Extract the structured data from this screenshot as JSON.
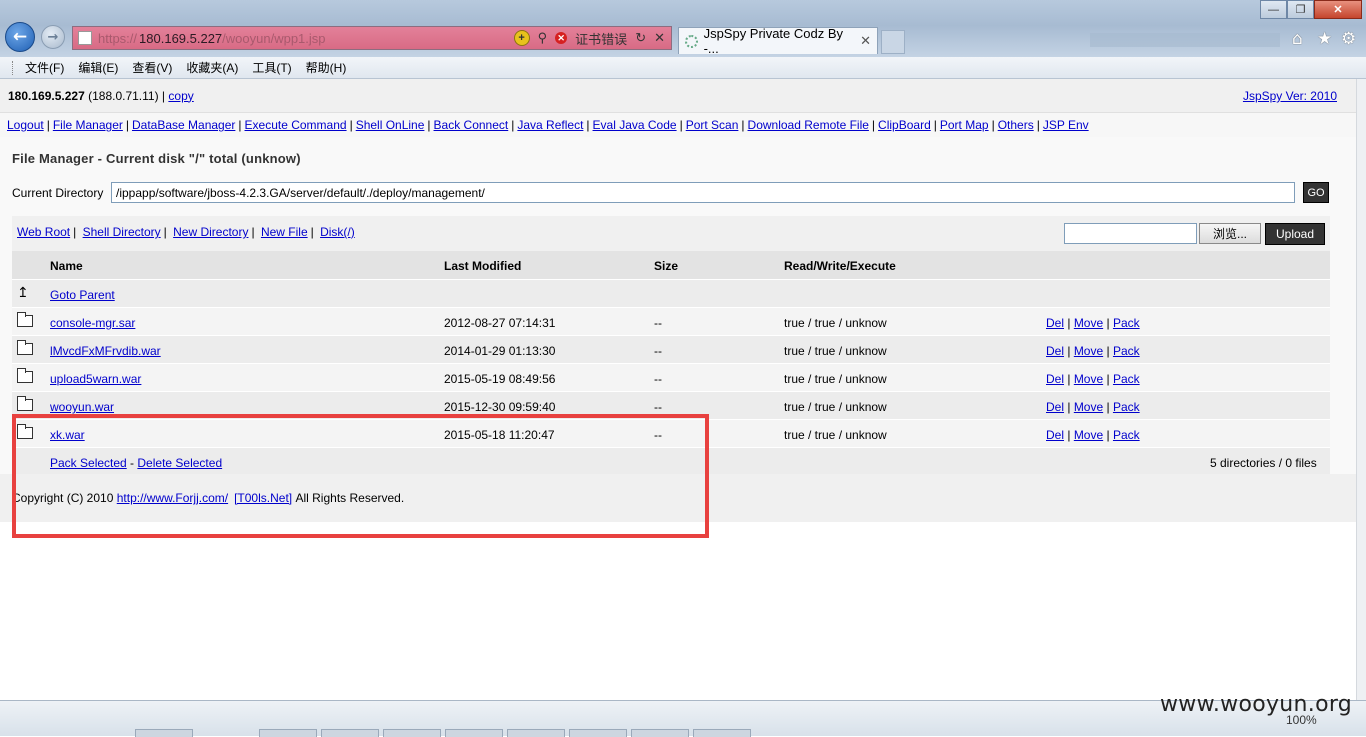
{
  "browser": {
    "url_scheme": "https://",
    "url_host": "180.169.5.227",
    "url_path": "/wooyun/wpp1.jsp",
    "cert_error": "证书错误",
    "tab_title": "JspSpy Private Codz By -...",
    "menu": [
      "文件(F)",
      "编辑(E)",
      "查看(V)",
      "收藏夹(A)",
      "工具(T)",
      "帮助(H)"
    ],
    "zoom": "100%"
  },
  "header": {
    "ip": "180.169.5.227",
    "local_ip": "(188.0.71.11)",
    "copy_label": "copy",
    "version_label": "JspSpy Ver: 2010"
  },
  "nav": [
    "Logout",
    "File Manager",
    "DataBase Manager",
    "Execute Command",
    "Shell OnLine",
    "Back Connect",
    "Java Reflect",
    "Eval Java Code",
    "Port Scan",
    "Download Remote File",
    "ClipBoard",
    "Port Map",
    "Others",
    "JSP Env"
  ],
  "file_manager": {
    "title": "File Manager - Current disk \"/\" total (unknow)",
    "current_directory_label": "Current Directory",
    "current_directory": "/ippapp/software/jboss-4.2.3.GA/server/default/./deploy/management/",
    "go_label": "GO",
    "dir_links": [
      "Web Root",
      "Shell Directory",
      "New Directory",
      "New File",
      "Disk(/)"
    ],
    "browse_label": "浏览...",
    "upload_label": "Upload",
    "columns": [
      "Name",
      "Last Modified",
      "Size",
      "Read/Write/Execute"
    ],
    "goto_parent": "Goto Parent",
    "rows": [
      {
        "name": "console-mgr.sar",
        "modified": "2012-08-27 07:14:31",
        "size": "--",
        "rwx": "true / true / unknow"
      },
      {
        "name": "lMvcdFxMFrvdib.war",
        "modified": "2014-01-29 01:13:30",
        "size": "--",
        "rwx": "true / true / unknow"
      },
      {
        "name": "upload5warn.war",
        "modified": "2015-05-19 08:49:56",
        "size": "--",
        "rwx": "true / true / unknow"
      },
      {
        "name": "wooyun.war",
        "modified": "2015-12-30 09:59:40",
        "size": "--",
        "rwx": "true / true / unknow"
      },
      {
        "name": "xk.war",
        "modified": "2015-05-18 11:20:47",
        "size": "--",
        "rwx": "true / true / unknow"
      }
    ],
    "actions": {
      "del": "Del",
      "move": "Move",
      "pack": "Pack"
    },
    "pack_selected": "Pack Selected",
    "dash": " - ",
    "delete_selected": "Delete Selected",
    "summary": "5 directories / 0 files"
  },
  "footer": {
    "copyright": "Copyright (C) 2010",
    "link1": "http://www.Forjj.com/",
    "link2": "[T00ls.Net]",
    "rights": "All Rights Reserved."
  },
  "watermark": "www.wooyun.org",
  "colors": {
    "highlight": "#e8413f",
    "link": "#0000cc"
  }
}
